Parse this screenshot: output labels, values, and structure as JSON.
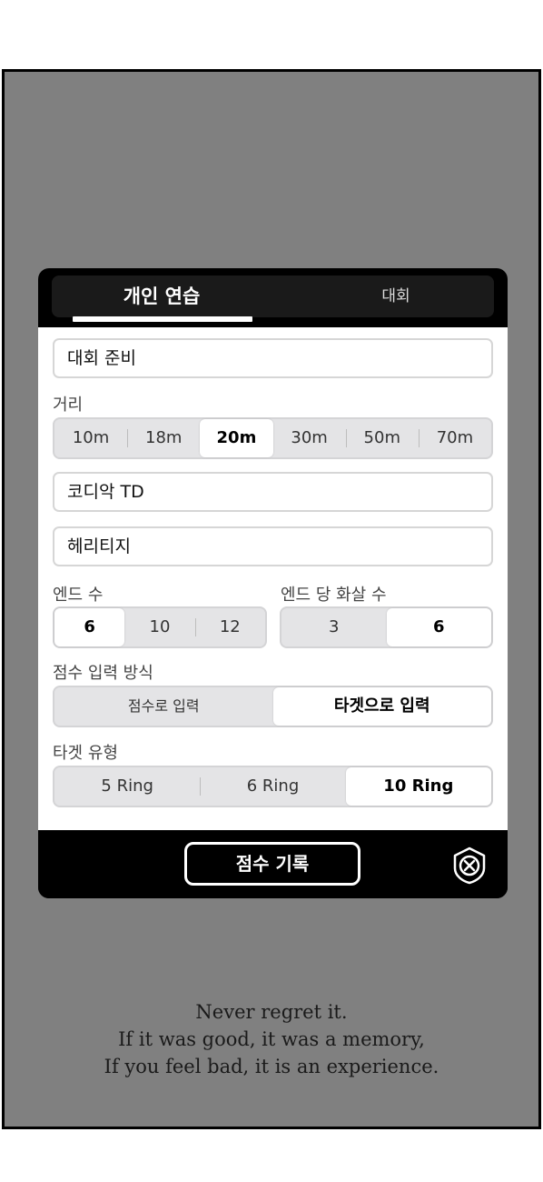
{
  "tabs": [
    {
      "label": "개인 연습",
      "selected": true
    },
    {
      "label": "대회",
      "selected": false
    }
  ],
  "form": {
    "title_value": "대회 준비",
    "distance_label": "거리",
    "distances": [
      "10m",
      "18m",
      "20m",
      "30m",
      "50m",
      "70m"
    ],
    "distance_selected": "20m",
    "bow_value": "코디악 TD",
    "arrow_value": "헤리티지",
    "ends_label": "엔드 수",
    "ends_options": [
      "6",
      "10",
      "12"
    ],
    "ends_selected": "6",
    "arrows_per_end_label": "엔드 당 화살 수",
    "arrows_per_end_options": [
      "3",
      "6"
    ],
    "arrows_per_end_selected": "6",
    "input_method_label": "점수 입력 방식",
    "input_method_options": [
      "점수로 입력",
      "타겟으로 입력"
    ],
    "input_method_selected": "타겟으로 입력",
    "target_type_label": "타겟 유형",
    "target_type_options": [
      "5 Ring",
      "6 Ring",
      "10 Ring"
    ],
    "target_type_selected": "10 Ring"
  },
  "footer": {
    "record_label": "점수 기록",
    "close_icon": "shield-x-icon"
  },
  "quote": {
    "line1": "Never regret it.",
    "line2": "If it was good, it was a memory,",
    "line3": "If you feel bad, it is an experience."
  }
}
